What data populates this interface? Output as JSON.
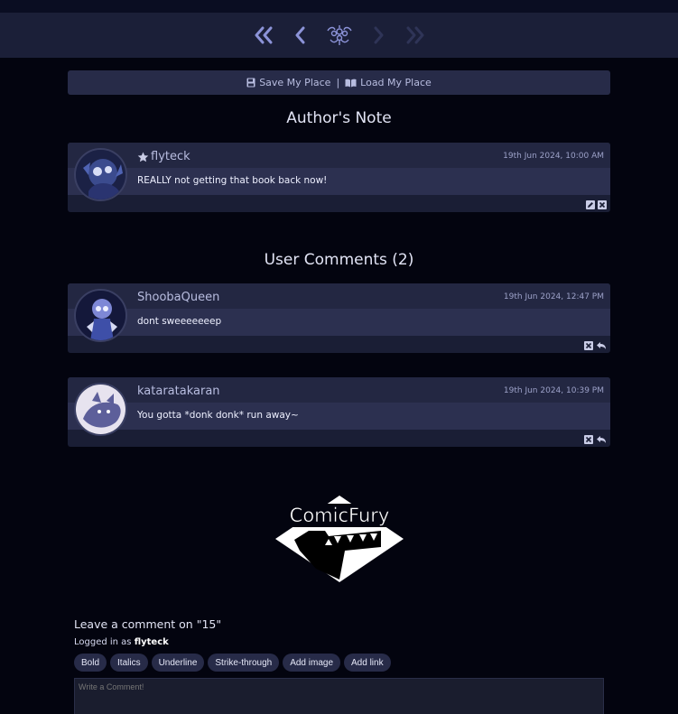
{
  "nav": {
    "first_icon": "double-chevron-left-icon",
    "prev_icon": "chevron-left-icon",
    "home_icon": "ornament-icon",
    "next_icon": "chevron-right-icon",
    "last_icon": "double-chevron-right-icon"
  },
  "place": {
    "save_label": "Save My Place",
    "separator": "|",
    "load_label": "Load My Place"
  },
  "authors_note": {
    "title": "Author's Note",
    "comment": {
      "username": "flyteck",
      "date": "19th Jun 2024, 10:00 AM",
      "text": "REALLY not getting that book back now!"
    }
  },
  "user_comments": {
    "title": "User Comments (2)",
    "items": [
      {
        "username": "ShoobaQueen",
        "date": "19th Jun 2024, 12:47 PM",
        "text": "dont sweeeeeeep"
      },
      {
        "username": "kataratakaran",
        "date": "19th Jun 2024, 10:39 PM",
        "text": "You gotta *donk donk* run away~"
      }
    ]
  },
  "logo": {
    "text": "ComicFury"
  },
  "comment_form": {
    "heading": "Leave a comment on \"15\"",
    "logged_prefix": "Logged in as",
    "logged_user": "flyteck",
    "buttons": {
      "bold": "Bold",
      "italics": "Italics",
      "underline": "Underline",
      "strike": "Strike-through",
      "image": "Add image",
      "link": "Add link"
    },
    "placeholder": "Write a Comment!"
  },
  "colors": {
    "background": "#03040f",
    "panel": "#1a1e35",
    "accent": "#8c93d8",
    "disabled_nav": "#353a62"
  }
}
